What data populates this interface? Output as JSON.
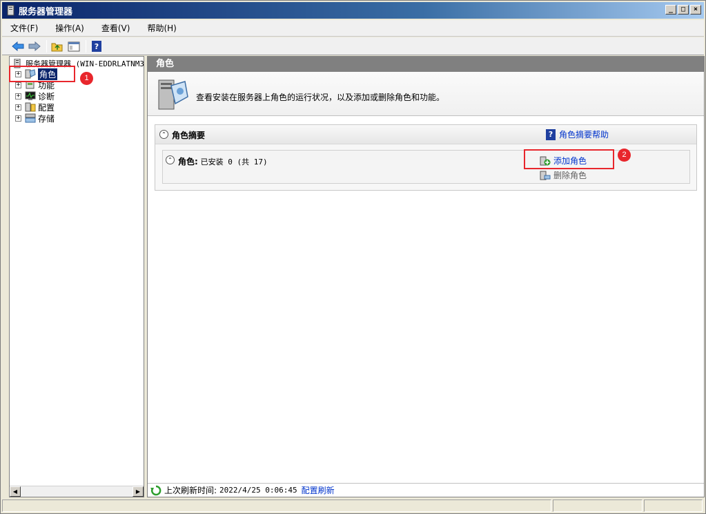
{
  "window": {
    "title": "服务器管理器"
  },
  "menu": [
    {
      "label": "文件(F)"
    },
    {
      "label": "操作(A)"
    },
    {
      "label": "查看(V)"
    },
    {
      "label": "帮助(H)"
    }
  ],
  "tree": {
    "root": "服务器管理器 (WIN-EDDRLATNM3",
    "items": [
      {
        "label": "角色",
        "expander": "+",
        "selected": true
      },
      {
        "label": "功能",
        "expander": "+"
      },
      {
        "label": "诊断",
        "expander": "+"
      },
      {
        "label": "配置",
        "expander": "+"
      },
      {
        "label": "存储",
        "expander": "+"
      }
    ]
  },
  "right": {
    "header": "角色",
    "intro": "查看安装在服务器上角色的运行状况，以及添加或删除角色和功能。",
    "summary": {
      "title": "角色摘要",
      "help": "角色摘要帮助",
      "roles_label": "角色:",
      "roles_status": "已安装 0 (共 17)",
      "add_role": "添加角色",
      "remove_role": "删除角色"
    },
    "refresh": {
      "label": "上次刷新时间:",
      "time": "2022/4/25 0:06:45",
      "link": "配置刷新"
    }
  },
  "annotations": {
    "badge1": "1",
    "badge2": "2"
  },
  "colors": {
    "annotation": "#e8262c",
    "link": "#0033cc",
    "selected": "#0a246a"
  }
}
